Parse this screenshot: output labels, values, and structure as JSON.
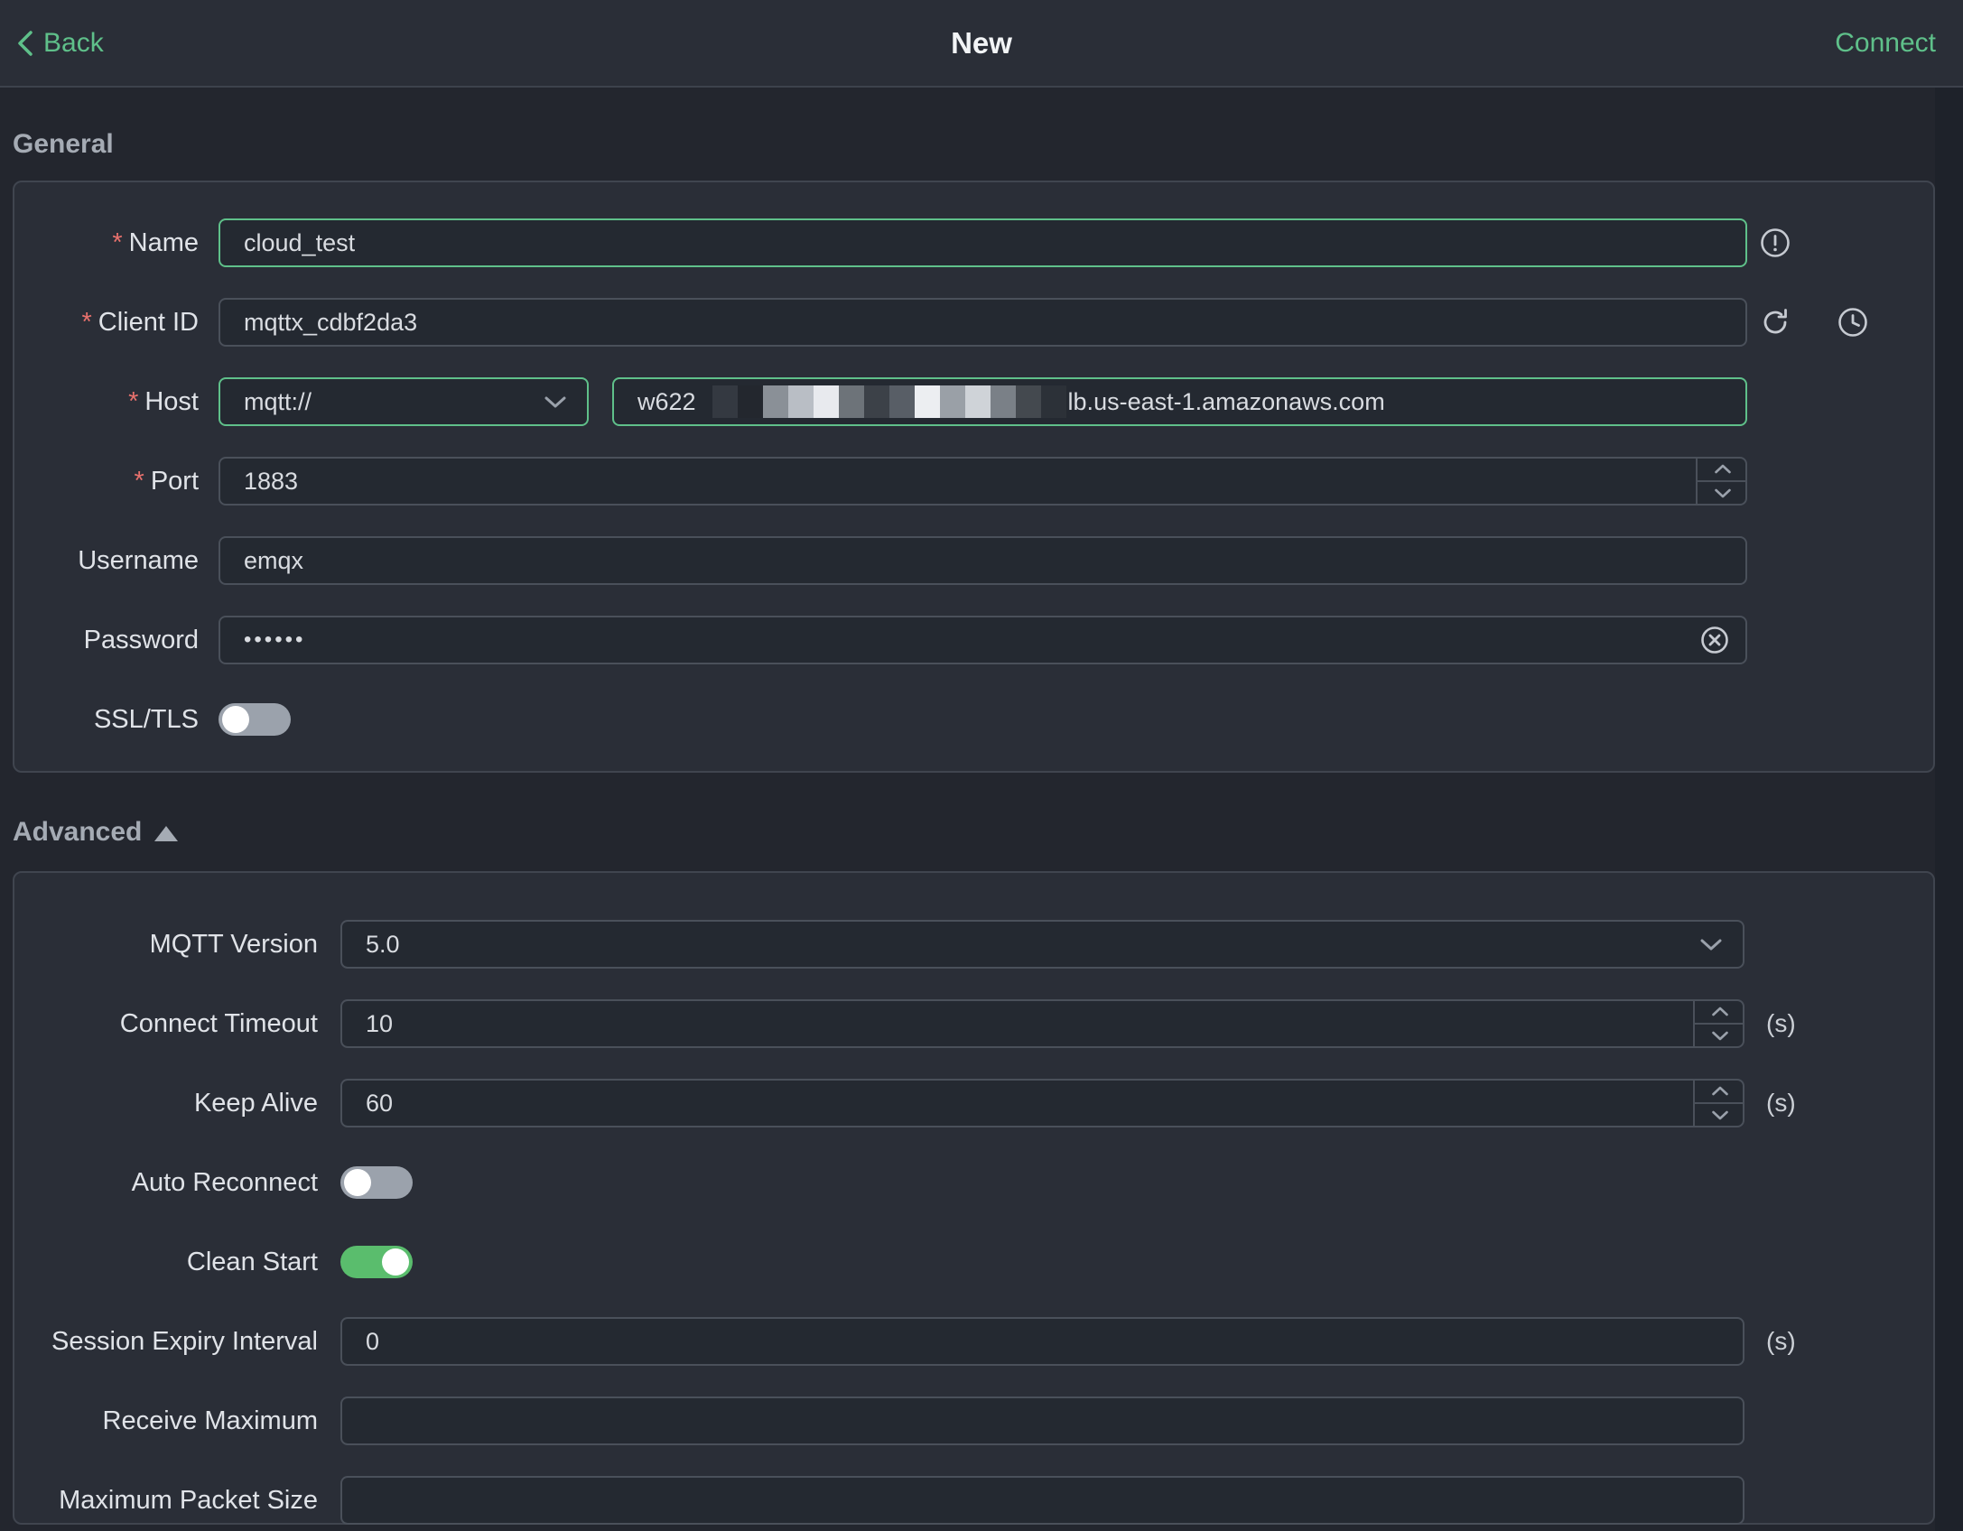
{
  "header": {
    "back_label": "Back",
    "title": "New",
    "connect_label": "Connect"
  },
  "misc": {
    "required_marker": "*"
  },
  "colors": {
    "accent_green": "#5fc08a",
    "toggle_on_green": "#5abd6d",
    "required_red": "#e8716d",
    "card_bg": "#2a2e37",
    "page_bg": "#23262e",
    "input_bg": "#242931"
  },
  "general": {
    "section_title": "General",
    "fields": {
      "name": {
        "label": "Name",
        "required": true,
        "value": "cloud_test"
      },
      "client_id": {
        "label": "Client ID",
        "required": true,
        "value": "mqttx_cdbf2da3"
      },
      "host": {
        "label": "Host",
        "required": true,
        "protocol": "mqtt://",
        "value_prefix": "w622",
        "value_suffix": "lb.us-east-1.amazonaws.com",
        "redaction_blocks": [
          "#343941",
          "#23272e",
          "#8a9097",
          "#b9bec5",
          "#e8eaee",
          "#6d7379",
          "#3c4148",
          "#585e66",
          "#eceef1",
          "#9aa0a7",
          "#cfd3d8",
          "#7a8087",
          "#44494f",
          "#2c3138"
        ]
      },
      "port": {
        "label": "Port",
        "required": true,
        "value": "1883"
      },
      "username": {
        "label": "Username",
        "required": false,
        "value": "emqx"
      },
      "password": {
        "label": "Password",
        "required": false,
        "masked_value": "••••••"
      },
      "ssl_tls": {
        "label": "SSL/TLS",
        "enabled": false
      }
    }
  },
  "advanced": {
    "section_title": "Advanced",
    "fields": {
      "mqtt_version": {
        "label": "MQTT Version",
        "value": "5.0"
      },
      "connect_timeout": {
        "label": "Connect Timeout",
        "value": "10",
        "unit": "(s)"
      },
      "keep_alive": {
        "label": "Keep Alive",
        "value": "60",
        "unit": "(s)"
      },
      "auto_reconnect": {
        "label": "Auto Reconnect",
        "enabled": false
      },
      "clean_start": {
        "label": "Clean Start",
        "enabled": true
      },
      "session_expiry": {
        "label": "Session Expiry Interval",
        "value": "0",
        "unit": "(s)"
      },
      "receive_maximum": {
        "label": "Receive Maximum",
        "value": ""
      },
      "max_packet_size": {
        "label": "Maximum Packet Size",
        "value": ""
      }
    }
  },
  "icons": {
    "back": "chevron-left-icon",
    "name_status": "circle-exclamation-icon",
    "client_id_refresh": "refresh-icon",
    "client_id_history": "clock-history-icon",
    "select_arrow": "chevron-down-icon",
    "stepper_up": "chevron-up-icon",
    "stepper_down": "chevron-down-icon",
    "password_clear": "circle-close-icon",
    "advanced_collapse": "triangle-up-icon"
  }
}
